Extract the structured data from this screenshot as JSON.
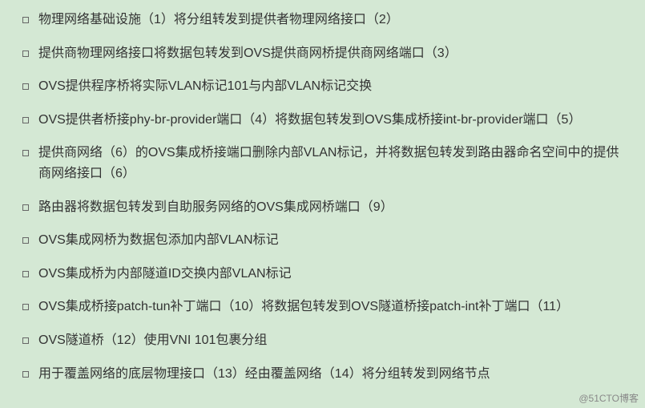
{
  "items": [
    "物理网络基础设施（1）将分组转发到提供者物理网络接口（2）",
    "提供商物理网络接口将数据包转发到OVS提供商网桥提供商网络端口（3）",
    "OVS提供程序桥将实际VLAN标记101与内部VLAN标记交换",
    "OVS提供者桥接phy-br-provider端口（4）将数据包转发到OVS集成桥接int-br-provider端口（5）",
    "提供商网络（6）的OVS集成桥接端口删除内部VLAN标记，并将数据包转发到路由器命名空间中的提供商网络接口（6）",
    "路由器将数据包转发到自助服务网络的OVS集成网桥端口（9）",
    "OVS集成网桥为数据包添加内部VLAN标记",
    "OVS集成桥为内部隧道ID交换内部VLAN标记",
    "OVS集成桥接patch-tun补丁端口（10）将数据包转发到OVS隧道桥接patch-int补丁端口（11）",
    "OVS隧道桥（12）使用VNI 101包裹分组",
    "用于覆盖网络的底层物理接口（13）经由覆盖网络（14）将分组转发到网络节点"
  ],
  "watermark": "@51CTO博客"
}
